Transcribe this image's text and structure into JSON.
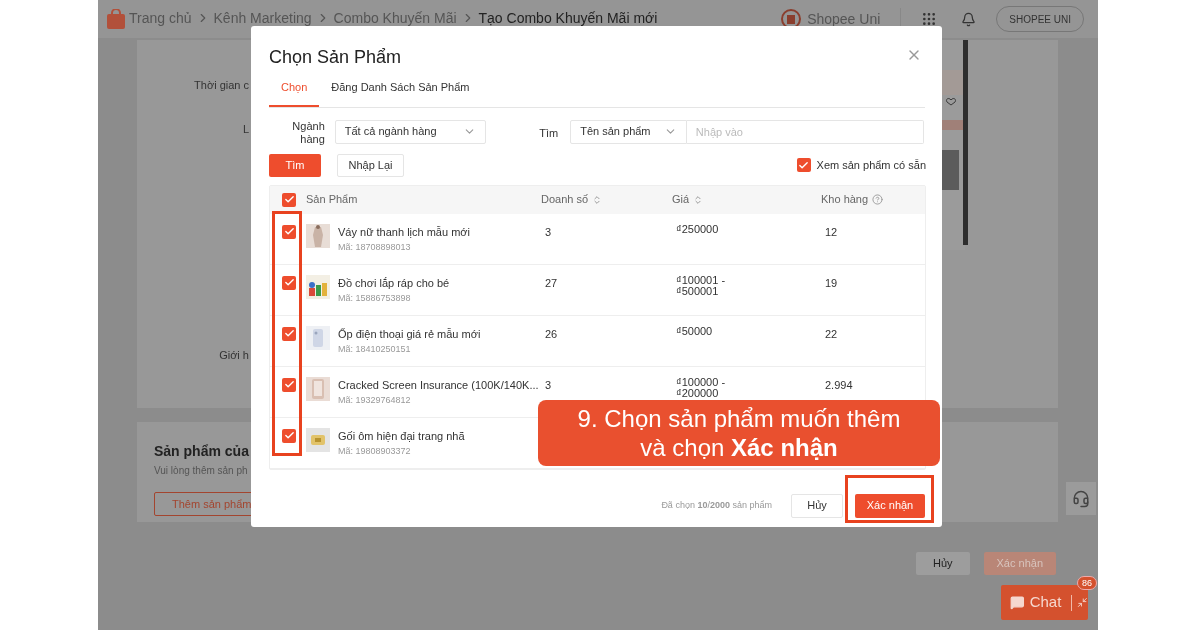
{
  "page": {
    "breadcrumb": [
      {
        "label": "Trang chủ",
        "current": false
      },
      {
        "label": "Kênh Marketing",
        "current": false
      },
      {
        "label": "Combo Khuyến Mãi",
        "current": false
      },
      {
        "label": "Tạo Combo Khuyến Mãi mới",
        "current": true
      }
    ],
    "brand": "Shopee Uni",
    "account": "SHOPEE UNI",
    "form_labels": [
      "Thời gian c",
      "L",
      "Giới h"
    ],
    "products_section": {
      "title": "Sản phẩm của",
      "hint": "Vui lòng thêm sản ph",
      "add_button": "Thêm sản phẩm"
    },
    "buttons": [
      {
        "label": "Hủy",
        "kind": "secondary",
        "disabled": false
      },
      {
        "label": "Xác nhận",
        "kind": "primary",
        "disabled": true
      }
    ],
    "chat": {
      "label": "Chat",
      "badge": "86"
    }
  },
  "dialog": {
    "title": "Chọn Sản Phẩm",
    "tabs": [
      {
        "label": "Chọn",
        "selected": true
      },
      {
        "label": "Đăng Danh Sách Sản Phẩm",
        "selected": false
      }
    ],
    "filters": {
      "category_label": "Ngành hàng",
      "category_value": "Tất cả ngành hàng",
      "search_label": "Tìm",
      "search_type": "Tên sản phẩm",
      "search_placeholder": "Nhập vào"
    },
    "search_button": "Tìm",
    "reset_button": "Nhập Lại",
    "in_stock": {
      "label": "Xem sản phẩm có sẵn",
      "checked": true
    },
    "table": {
      "select_all_checked": true,
      "columns": [
        {
          "label": "Sản Phẩm",
          "kind": "plain"
        },
        {
          "label": "Doanh số",
          "kind": "sort"
        },
        {
          "label": "Giá",
          "kind": "sort"
        },
        {
          "label": "Kho hàng",
          "kind": "help"
        }
      ],
      "rows": [
        {
          "name": "Váy nữ thanh lịch mẫu mới",
          "code": "Mã: 18708898013",
          "sales": "3",
          "price": "₫250000",
          "stock": "12",
          "checked": true
        },
        {
          "name": "Đồ chơi lắp ráp cho bé",
          "code": "Mã: 15886753898",
          "sales": "27",
          "price": "₫100001 - ₫500001",
          "stock": "19",
          "checked": true
        },
        {
          "name": "Ốp điện thoại giá rẻ mẫu mới",
          "code": "Mã: 18410250151",
          "sales": "26",
          "price": "₫50000",
          "stock": "22",
          "checked": true
        },
        {
          "name": "Cracked Screen Insurance (100K/140K...",
          "code": "Mã: 19329764812",
          "sales": "3",
          "price": "₫100000 - ₫200000",
          "stock": "2.994",
          "checked": true
        },
        {
          "name": "Gối ôm hiện đại trang nhã",
          "code": "Mã: 19808903372",
          "checked": true
        }
      ]
    },
    "footer": {
      "selected_text": "Đã chọn **10**/**2000** sản phẩm",
      "cancel": "Hủy",
      "confirm": "Xác nhận"
    }
  },
  "annotation": {
    "text": "9. Chọn sản phẩm muốn thêm và chọn **Xác nhận**"
  }
}
